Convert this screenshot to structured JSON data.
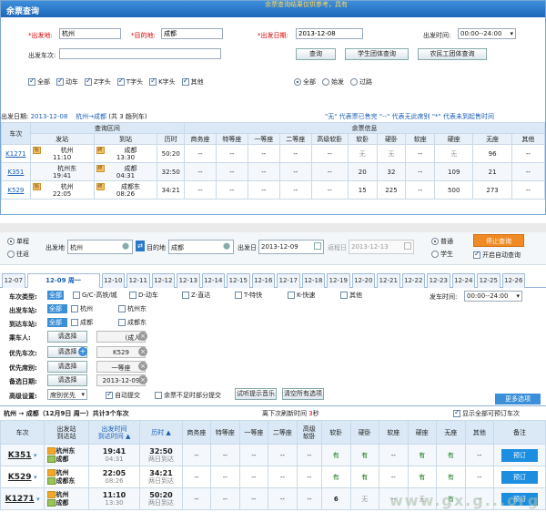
{
  "top": {
    "title": "余票查询",
    "notice": "余票查询结果仅供参考，具有",
    "from_label": "*出发地:",
    "from_value": "杭州",
    "to_label": "*目的地:",
    "to_value": "成都",
    "date_label": "*出发日期:",
    "date_value": "2013-12-08",
    "time_label": "出发时间:",
    "time_value": "00:00--24:00",
    "train_label": "出发车次:",
    "train_value": "",
    "query_btn": "查询",
    "student_btn": "学生团体查询",
    "worker_btn": "农民工团体查询",
    "types": [
      {
        "label": "全部",
        "checked": true
      },
      {
        "label": "动车",
        "checked": true
      },
      {
        "label": "Z字头",
        "checked": true
      },
      {
        "label": "T字头",
        "checked": true
      },
      {
        "label": "K字头",
        "checked": true
      },
      {
        "label": "其他",
        "checked": true
      }
    ],
    "station_types": [
      {
        "label": "全部",
        "selected": true
      },
      {
        "label": "始发",
        "selected": false
      },
      {
        "label": "过路",
        "selected": false
      }
    ],
    "result_date_label": "出发日期:",
    "result_date": "2013-12-08",
    "result_route": "杭州→成都",
    "result_count_text": "(共 3 趟列车)",
    "legend_text": "\"无\" 代表票已售完  \"--\" 代表无此席别  \"*\" 代表未到起售时间",
    "head_train": "车次",
    "head_section": "查询区间",
    "head_remain": "余票信息",
    "head_cols": [
      "发站",
      "到站",
      "历时",
      "商务座",
      "特等座",
      "一等座",
      "二等座",
      "高级软卧",
      "软卧",
      "硬卧",
      "软座",
      "硬座",
      "无座",
      "其他"
    ],
    "rows": [
      {
        "train": "K1271",
        "from": "杭州",
        "from_time": "11:10",
        "to": "成都",
        "to_time": "13:30",
        "dur": "50:20",
        "cells": [
          "--",
          "--",
          "--",
          "--",
          "--",
          "无",
          "无",
          "--",
          "无",
          "96",
          "--"
        ],
        "from_tag": "始",
        "to_tag": "终"
      },
      {
        "train": "K351",
        "from": "杭州东",
        "from_time": "19:41",
        "to": "成都",
        "to_time": "04:31",
        "dur": "32:50",
        "cells": [
          "--",
          "--",
          "--",
          "--",
          "--",
          "20",
          "32",
          "--",
          "109",
          "21",
          "--"
        ],
        "from_tag": "",
        "to_tag": "终"
      },
      {
        "train": "K529",
        "from": "杭州",
        "from_time": "22:05",
        "to": "成都东",
        "to_time": "08:26",
        "dur": "34:21",
        "cells": [
          "--",
          "--",
          "--",
          "--",
          "--",
          "15",
          "225",
          "--",
          "500",
          "273",
          "--"
        ],
        "from_tag": "始",
        "to_tag": "终"
      }
    ]
  },
  "bottom": {
    "trip_types": [
      {
        "label": "单程",
        "selected": true
      },
      {
        "label": "往返",
        "selected": false
      }
    ],
    "from_label": "出发地",
    "from_value": "杭州",
    "to_label": "目的地",
    "to_value": "成都",
    "date_label": "出发日",
    "date_value": "2013-12-09",
    "return_label": "返程日",
    "return_value": "2013-12-13",
    "ticket_types": [
      {
        "label": "普通",
        "selected": true
      },
      {
        "label": "学生",
        "selected": false
      }
    ],
    "stop_btn": "停止查询",
    "auto_label": "开启自动查询",
    "auto_checked": true,
    "date_tabs": [
      "12-07",
      "12-09 周一",
      "12-10",
      "12-11",
      "12-12",
      "12-13",
      "12-14",
      "12-15",
      "12-16",
      "12-17",
      "12-18",
      "12-19",
      "12-20",
      "12-21",
      "12-22",
      "12-23",
      "12-24",
      "12-25",
      "12-26"
    ],
    "active_tab": 1,
    "type_label": "车次类型:",
    "type_all": "全部",
    "type_items": [
      "G/C-高铁/城",
      "D-动车",
      "Z-直达",
      "T-特快",
      "K-快速",
      "其他"
    ],
    "depart_time_label": "发车时间:",
    "depart_time_value": "00:00--24:00",
    "from_station_label": "出发车站:",
    "from_station_items": [
      "全部",
      "杭州",
      "杭州东"
    ],
    "to_station_label": "到达车站:",
    "to_station_items": [
      "全部",
      "成都",
      "成都东"
    ],
    "passenger_label": "乘车人:",
    "passenger_btn": "请选择",
    "passenger_chip": "(成人)",
    "pri_train_label": "优先车次:",
    "pri_train_btn": "请选择",
    "pri_train_chip": "K529",
    "pri_seat_label": "优先席别:",
    "pri_seat_btn": "请选择",
    "pri_seat_chip": "一等座",
    "alt_date_label": "备选日期:",
    "alt_date_btn": "请选择",
    "alt_date_chip": "2013-12-09",
    "adv_label": "高级设置:",
    "adv_select": "席别优先",
    "auto_submit": "自动提交",
    "partial_submit": "余票不足时部分提交",
    "test_music": "试听提示音乐",
    "clear_btn": "清空所有选项",
    "more_btn": "更多选项",
    "result_route": "杭州 → 成都（12月9日 周一）共计3个车次",
    "refresh_text": "离下次刷新时间",
    "refresh_seconds": "3",
    "refresh_unit": "秒",
    "show_all_label": "显示全部可预订车次",
    "heads": [
      "车次",
      "出发站\n到达站",
      "出发时间\n到达时间",
      "历时",
      "商务座",
      "特等座",
      "一等座",
      "二等座",
      "高级\n软卧",
      "软卧",
      "硬卧",
      "软座",
      "硬座",
      "无座",
      "其他",
      "备注"
    ],
    "rows": [
      {
        "train": "K351",
        "from": "杭州东",
        "to": "成都",
        "dep": "19:41",
        "arr": "04:31",
        "dur": "32:50",
        "arr_day": "两日到达",
        "cells": [
          "--",
          "--",
          "--",
          "--",
          "--",
          "有",
          "有",
          "--",
          "有",
          "有",
          "--"
        ],
        "book": "预订"
      },
      {
        "train": "K529",
        "from": "杭州",
        "to": "成都东",
        "dep": "22:05",
        "arr": "08:26",
        "dur": "34:21",
        "arr_day": "两日到达",
        "cells": [
          "--",
          "--",
          "--",
          "--",
          "--",
          "有",
          "有",
          "--",
          "有",
          "有",
          "--"
        ],
        "book": "预订"
      },
      {
        "train": "K1271",
        "from": "杭州",
        "to": "成都",
        "dep": "11:10",
        "arr": "13:30",
        "dur": "50:20",
        "arr_day": "两日到达",
        "cells": [
          "--",
          "--",
          "--",
          "--",
          "--",
          "6",
          "无",
          "--",
          "无",
          "有",
          "--"
        ],
        "book": "预订"
      }
    ]
  },
  "watermark": "www.gx.g...org"
}
